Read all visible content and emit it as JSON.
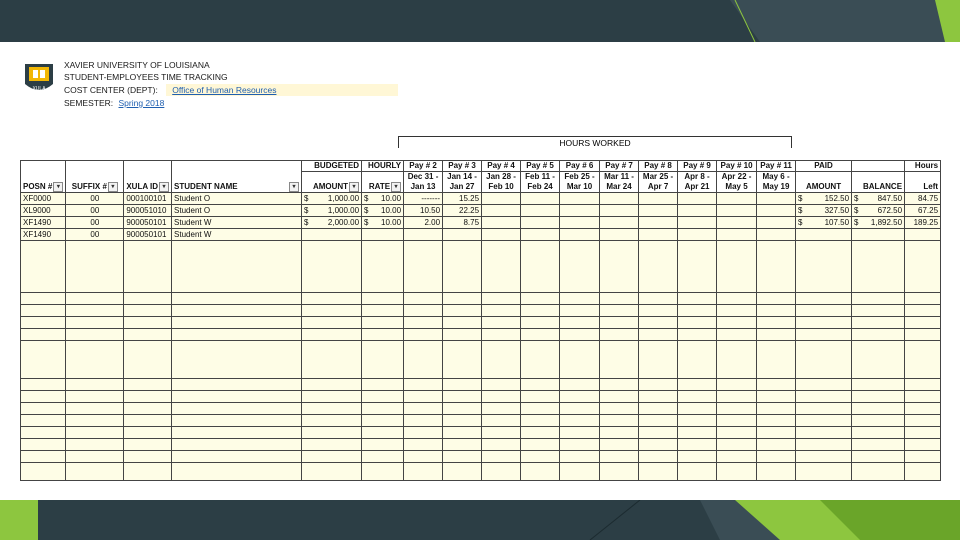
{
  "header": {
    "university": "XAVIER UNIVERSITY OF LOUISIANA",
    "subtitle": "STUDENT-EMPLOYEES TIME TRACKING",
    "cost_center_label": "COST CENTER (DEPT):",
    "cost_center_value": "Office of Human Resources",
    "semester_label": "SEMESTER:",
    "semester_value": "Spring 2018",
    "logo_text": "XULA"
  },
  "hours_worked_title": "HOURS WORKED",
  "columns": {
    "posn": "POSN #",
    "suffix": "SUFFIX #",
    "xulaid": "XULA ID",
    "student_name": "STUDENT NAME",
    "budgeted_top": "BUDGETED",
    "budgeted_bot": "AMOUNT",
    "hourly_top": "HOURLY",
    "hourly_bot": "RATE",
    "paid_top": "PAID",
    "paid_bot": "AMOUNT",
    "balance": "BALANCE",
    "hours_top": "Hours",
    "hours_bot": "Left"
  },
  "pay_periods": [
    {
      "pay": "Pay # 2",
      "from": "Dec 31 -",
      "to": "Jan 13"
    },
    {
      "pay": "Pay # 3",
      "from": "Jan 14 -",
      "to": "Jan 27"
    },
    {
      "pay": "Pay # 4",
      "from": "Jan 28 -",
      "to": "Feb 10"
    },
    {
      "pay": "Pay # 5",
      "from": "Feb 11 -",
      "to": "Feb 24"
    },
    {
      "pay": "Pay # 6",
      "from": "Feb 25 -",
      "to": "Mar 10"
    },
    {
      "pay": "Pay # 7",
      "from": "Mar 11 -",
      "to": "Mar 24"
    },
    {
      "pay": "Pay # 8",
      "from": "Mar 25 -",
      "to": "Apr 7"
    },
    {
      "pay": "Pay # 9",
      "from": "Apr 8 -",
      "to": "Apr 21"
    },
    {
      "pay": "Pay # 10",
      "from": "Apr 22 -",
      "to": "May 5"
    },
    {
      "pay": "Pay # 11",
      "from": "May 6 -",
      "to": "May 19"
    }
  ],
  "rows": [
    {
      "posn": "XF0000",
      "suffix": "00",
      "xulaid": "000100101",
      "name": "Student O",
      "budget": "1,000.00",
      "rate": "10.00",
      "hours": [
        "-------",
        "15.25",
        "",
        "",
        "",
        "",
        "",
        "",
        "",
        ""
      ],
      "paid": "152.50",
      "balance": "847.50",
      "left": "84.75"
    },
    {
      "posn": "XL9000",
      "suffix": "00",
      "xulaid": "900051010",
      "name": "Student O",
      "budget": "1,000.00",
      "rate": "10.00",
      "hours": [
        "10.50",
        "22.25",
        "",
        "",
        "",
        "",
        "",
        "",
        "",
        ""
      ],
      "paid": "327.50",
      "balance": "672.50",
      "left": "67.25"
    },
    {
      "posn": "XF1490",
      "suffix": "00",
      "xulaid": "900050101",
      "name": "Student W",
      "budget": "2,000.00",
      "rate": "10.00",
      "hours": [
        "2.00",
        "8.75",
        "",
        "",
        "",
        "",
        "",
        "",
        "",
        ""
      ],
      "paid": "107.50",
      "balance": "1,892.50",
      "left": "189.25"
    },
    {
      "posn": "XF1490",
      "suffix": "00",
      "xulaid": "900050101",
      "name": "Student W",
      "budget": "",
      "rate": "",
      "hours": [
        "",
        "",
        "",
        "",
        "",
        "",
        "",
        "",
        "",
        ""
      ],
      "paid": "",
      "balance": "",
      "left": ""
    }
  ],
  "currency": "$",
  "colors": {
    "dark": "#2c3e45",
    "green": "#8dc63f",
    "green_dark": "#6aa529",
    "cell_fill": "#fefde6"
  }
}
